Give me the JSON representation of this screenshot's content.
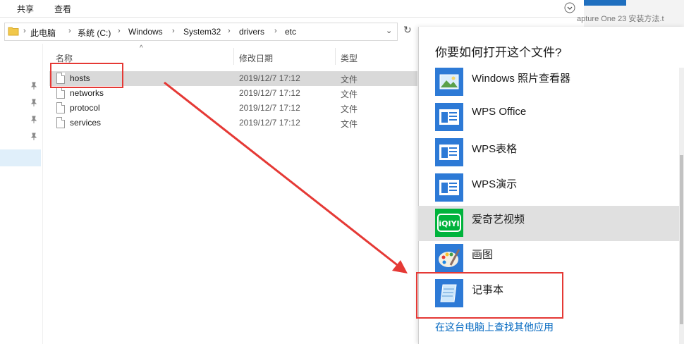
{
  "ribbon": {
    "tabs": [
      "共享",
      "查看"
    ]
  },
  "address": {
    "crumbs": [
      "此电脑",
      "系统 (C:)",
      "Windows",
      "System32",
      "drivers",
      "etc"
    ]
  },
  "file_list": {
    "columns": {
      "name": "名称",
      "date": "修改日期",
      "type": "类型"
    },
    "rows": [
      {
        "name": "hosts",
        "date": "2019/12/7 17:12",
        "type": "文件"
      },
      {
        "name": "networks",
        "date": "2019/12/7 17:12",
        "type": "文件"
      },
      {
        "name": "protocol",
        "date": "2019/12/7 17:12",
        "type": "文件"
      },
      {
        "name": "services",
        "date": "2019/12/7 17:12",
        "type": "文件"
      }
    ]
  },
  "background_window": {
    "title": "apture One 23 安装方法.t"
  },
  "dialog": {
    "title": "你要如何打开这个文件?",
    "apps": [
      {
        "label": "Windows 照片查看器",
        "icon": "photo-viewer-icon"
      },
      {
        "label": "WPS Office",
        "icon": "wps-icon"
      },
      {
        "label": "WPS表格",
        "icon": "wps-icon"
      },
      {
        "label": "WPS演示",
        "icon": "wps-icon"
      },
      {
        "label": "爱奇艺视频",
        "icon": "iqiyi-icon"
      },
      {
        "label": "画图",
        "icon": "paint-icon"
      },
      {
        "label": "记事本",
        "icon": "notepad-icon"
      }
    ],
    "more_link": "在这台电脑上查找其他应用"
  },
  "colors": {
    "accent": "#0067c0",
    "highlight_red": "#e53935",
    "tile_blue": "#2d7ad6",
    "iqiyi_green": "#00b33c"
  }
}
